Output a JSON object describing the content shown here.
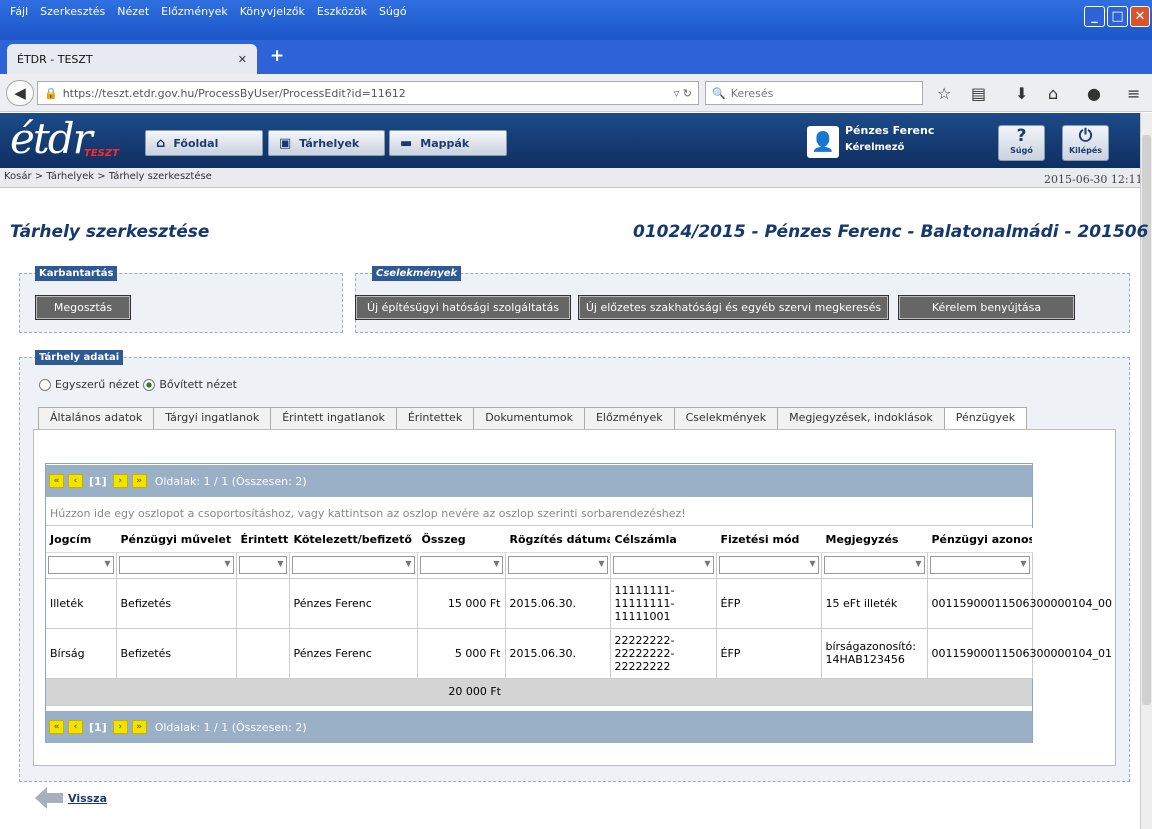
{
  "browser": {
    "menu": [
      "Fájl",
      "Szerkesztés",
      "Nézet",
      "Előzmények",
      "Könyvjelzők",
      "Eszközök",
      "Súgó"
    ],
    "tab_title": "ÉTDR - TESZT",
    "url": "https://teszt.etdr.gov.hu/ProcessByUser/ProcessEdit?id=11612",
    "search_placeholder": "Keresés"
  },
  "header": {
    "logo": "étdr",
    "logo_badge": "TESZT",
    "nav": [
      "Főoldal",
      "Tárhelyek",
      "Mappák"
    ],
    "user_name": "Pénzes Ferenc",
    "user_role": "Kérelmező",
    "help_label": "Súgó",
    "logout_label": "Kilépés"
  },
  "breadcrumb": "Kosár > Tárhelyek > Tárhely szerkesztése",
  "datetime": "2015-06-30 12:11",
  "page": {
    "title": "Tárhely szerkesztése",
    "info": "01024/2015 - Pénzes Ferenc - Balatonalmádi - 201506"
  },
  "karbantartas": {
    "legend": "Karbantartás",
    "share_button": "Megosztás"
  },
  "cselekmenyek": {
    "legend": "Cselekmények",
    "buttons": [
      "Új építésügyi hatósági szolgáltatás",
      "Új előzetes szakhatósági és egyéb szervi megkeresés",
      "Kérelem benyújtása"
    ]
  },
  "tarhely": {
    "legend": "Tárhely adatai",
    "view_simple": "Egyszerű nézet",
    "view_extended": "Bővített nézet",
    "tabs": [
      "Általános adatok",
      "Tárgyi ingatlanok",
      "Érintett ingatlanok",
      "Érintettek",
      "Dokumentumok",
      "Előzmények",
      "Cselekmények",
      "Megjegyzések, indoklások",
      "Pénzügyek"
    ]
  },
  "grid": {
    "pager_current": "[1]",
    "pager_info": "Oldalak: 1 / 1 (Összesen: 2)",
    "group_hint": "Húzzon ide egy oszlopot a csoportosításhoz, vagy kattintson az oszlop nevére az oszlop szerinti sorbarendezéshez!",
    "columns": [
      "Jogcím",
      "Pénzügyi művelet",
      "Érintett",
      "Kötelezett/befizető",
      "Összeg",
      "Rögzítés dátuma",
      "Célszámla",
      "Fizetési mód",
      "Megjegyzés",
      "Pénzügyi azonos"
    ],
    "rows": [
      [
        "Illeték",
        "Befizetés",
        "",
        "Pénzes Ferenc",
        "15 000 Ft",
        "2015.06.30.",
        "11111111-11111111-11111001",
        "ÉFP",
        "15 eFt illeték",
        "001159000115063000001​04_00"
      ],
      [
        "Bírság",
        "Befizetés",
        "",
        "Pénzes Ferenc",
        "5 000 Ft",
        "2015.06.30.",
        "22222222-22222222-22222222",
        "ÉFP",
        "bírságazonosító: 14HAB123456",
        "001159000115063000001​04_01"
      ]
    ],
    "total": "20 000 Ft"
  },
  "back_link": "Vissza"
}
